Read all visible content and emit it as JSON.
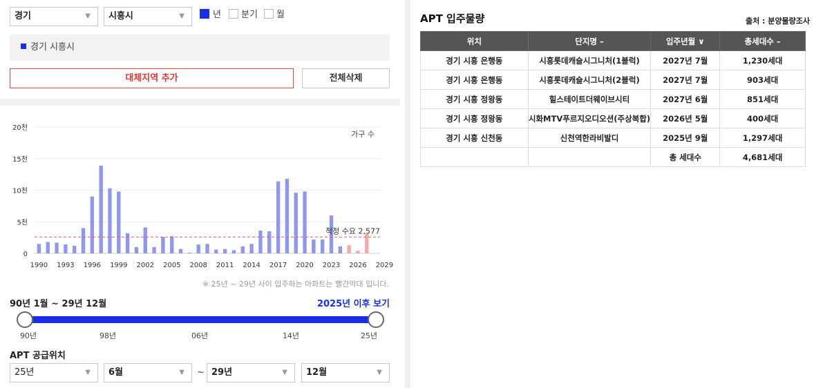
{
  "filters": {
    "province": "경기",
    "city": "시흥시",
    "period_options": [
      {
        "label": "년",
        "checked": true
      },
      {
        "label": "분기",
        "checked": false
      },
      {
        "label": "월",
        "checked": false
      }
    ]
  },
  "selected_regions": [
    "경기 시흥시"
  ],
  "buttons": {
    "add_region": "대체지역 추가",
    "delete_all": "전체삭제"
  },
  "chart_data": {
    "type": "bar",
    "legend": "가구 수",
    "y_ticks": [
      "0",
      "5천",
      "10천",
      "15천",
      "20천"
    ],
    "ylim": [
      0,
      20000
    ],
    "x_ticks": [
      "1990",
      "1993",
      "1996",
      "1999",
      "2002",
      "2005",
      "2008",
      "2011",
      "2014",
      "2017",
      "2020",
      "2023",
      "2026",
      "2029"
    ],
    "categories": [
      1990,
      1991,
      1992,
      1993,
      1994,
      1995,
      1996,
      1997,
      1998,
      1999,
      2000,
      2001,
      2002,
      2003,
      2004,
      2005,
      2006,
      2007,
      2008,
      2009,
      2010,
      2011,
      2012,
      2013,
      2014,
      2015,
      2016,
      2017,
      2018,
      2019,
      2020,
      2021,
      2022,
      2023,
      2024,
      2025,
      2026,
      2027
    ],
    "values": [
      1500,
      1800,
      1700,
      1400,
      1200,
      4000,
      9000,
      13900,
      10300,
      9800,
      3200,
      1000,
      4100,
      1000,
      2600,
      2700,
      700,
      100,
      1400,
      1500,
      600,
      700,
      500,
      1100,
      1500,
      3600,
      3500,
      11400,
      11800,
      9600,
      9800,
      2200,
      2200,
      6000,
      1100,
      1297,
      400,
      3100
    ],
    "highlight_from": 2025,
    "colors": {
      "normal": "#8f97ee",
      "highlight": "#f5a8a8",
      "reference": "#e06060"
    },
    "reference_line": {
      "value": 2577,
      "label": "적정 수요 2,577"
    }
  },
  "chart_note": "※ 25년 ~ 29년 사이 입주하는 아파트는 빨간막대 입니다.",
  "range": {
    "label": "90년 1월 ~ 29년 12월",
    "link": "2025년 이후 보기",
    "ticks": [
      "90년",
      "98년",
      "06년",
      "14년",
      "25년"
    ],
    "start_fraction": 0,
    "end_fraction": 1
  },
  "supply": {
    "title": "APT 공급위치",
    "from_year": "25년",
    "from_month": "6월",
    "tilde": "~",
    "to_year": "29년",
    "to_month": "12월"
  },
  "apt_panel": {
    "title": "APT 입주물량",
    "source": "출처 : 분양물량조사",
    "columns": [
      "위치",
      "단지명 –",
      "입주년월 ∨",
      "총세대수 –"
    ],
    "rows": [
      [
        "경기 시흥 은행동",
        "시흥롯데캐슬시그니처(1블럭)",
        "2027년 7월",
        "1,230세대"
      ],
      [
        "경기 시흥 은행동",
        "시흥롯데캐슬시그니처(2블럭)",
        "2027년 7월",
        "903세대"
      ],
      [
        "경기 시흥 정왕동",
        "힐스테이트더웨이브시티",
        "2027년 6월",
        "851세대"
      ],
      [
        "경기 시흥 정왕동",
        "시화MTV푸르지오디오션(주상복합)",
        "2026년 5월",
        "400세대"
      ],
      [
        "경기 시흥 신천동",
        "신천역한라비발디",
        "2025년 9월",
        "1,297세대"
      ]
    ],
    "total_label": "총 세대수",
    "total_value": "4,681세대"
  }
}
